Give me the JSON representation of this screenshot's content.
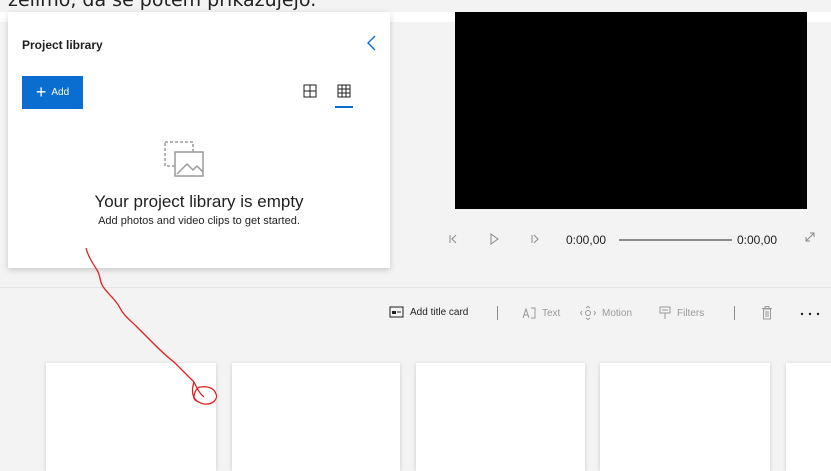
{
  "caption": "želimo, da se potem prikazujejo.",
  "library": {
    "title": "Project library",
    "add_label": "Add",
    "empty_title": "Your project library is empty",
    "empty_subtitle": "Add photos and video clips to get started."
  },
  "player": {
    "current_time": "0:00,00",
    "total_time": "0:00,00"
  },
  "toolbar": {
    "add_title_card": "Add title card",
    "text": "Text",
    "motion": "Motion",
    "filters": "Filters"
  },
  "colors": {
    "accent": "#0a6ed1",
    "annotation": "#e02020"
  },
  "icons": [
    "collapse-chevron-icon",
    "large-grid-icon",
    "small-grid-icon",
    "photos-placeholder-icon",
    "step-back-icon",
    "play-icon",
    "step-forward-icon",
    "fullscreen-icon",
    "title-card-icon",
    "text-icon",
    "motion-icon",
    "filters-icon",
    "trash-icon",
    "more-icon"
  ]
}
